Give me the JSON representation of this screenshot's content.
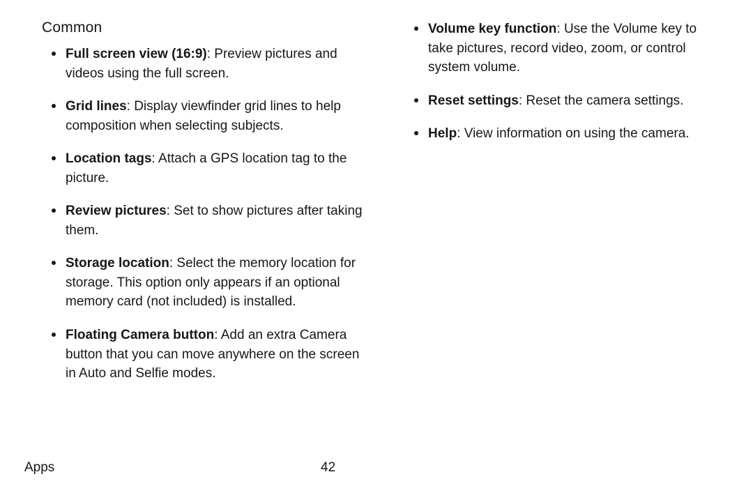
{
  "section_title": "Common",
  "left_items": [
    {
      "term": "Full screen view (16:9)",
      "desc": ": Preview pictures and videos using the full screen."
    },
    {
      "term": "Grid lines",
      "desc": ": Display viewfinder grid lines to help composition when selecting subjects."
    },
    {
      "term": "Location tags",
      "desc": ": Attach a GPS location tag to the picture."
    },
    {
      "term": "Review pictures",
      "desc": ": Set to show pictures after taking them."
    },
    {
      "term": "Storage location",
      "desc": ": Select the memory location for storage. This option only appears if an optional memory card (not included) is installed."
    },
    {
      "term": "Floating Camera button",
      "desc": ": Add an extra Camera button that you can move anywhere on the screen in Auto and Selfie modes."
    }
  ],
  "right_items": [
    {
      "term": "Volume key function",
      "desc": ": Use the Volume key to take pictures, record video, zoom, or control system volume."
    },
    {
      "term": "Reset settings",
      "desc": ": Reset the camera settings."
    },
    {
      "term": "Help",
      "desc": ": View information on using the camera."
    }
  ],
  "footer_label": "Apps",
  "page_number": "42"
}
